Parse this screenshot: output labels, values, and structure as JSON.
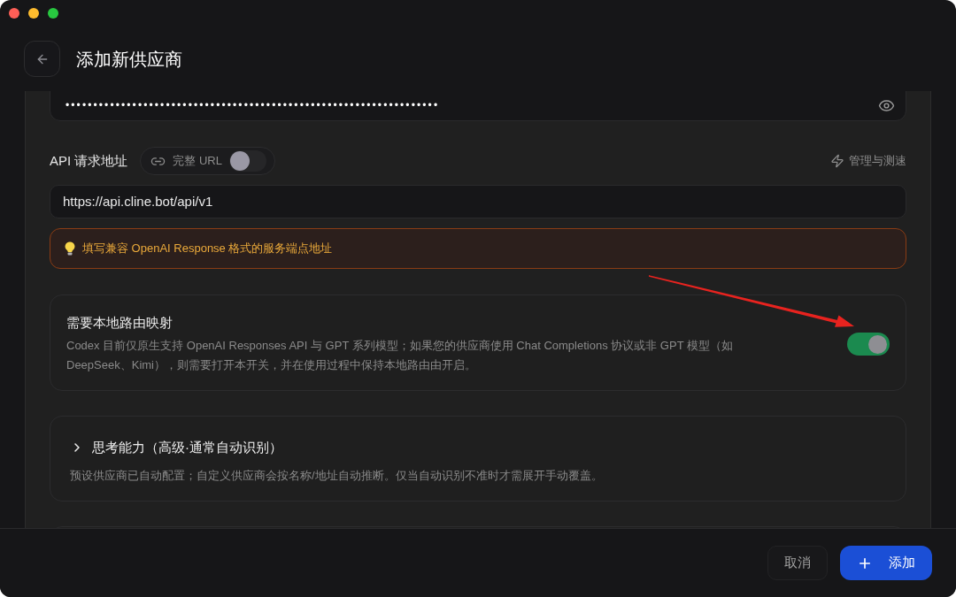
{
  "header": {
    "title": "添加新供应商"
  },
  "api_key_field": {
    "value": "•••••••••••••••••••••••••••••••••••••••••••••••••••••••••••••••••••"
  },
  "endpoint": {
    "label": "API 请求地址",
    "full_url": {
      "label": "完整 URL",
      "on": false
    },
    "manage_link": "管理与测速",
    "value": "https://api.cline.bot/api/v1",
    "hint": "填写兼容 OpenAI Response 格式的服务端点地址"
  },
  "local_routing": {
    "title": "需要本地路由映射",
    "description": "Codex 目前仅原生支持 OpenAI Responses API 与 GPT 系列模型；如果您的供应商使用 Chat Completions 协议或非 GPT 模型（如 DeepSeek、Kimi），则需要打开本开关，并在使用过程中保持本地路由由开启。",
    "on": true
  },
  "thinking": {
    "title": "思考能力（高级·通常自动识别）",
    "description": "预设供应商已自动配置；自定义供应商会按名称/地址自动推断。仅当自动识别不准时才需展开手动覆盖。",
    "expanded": false
  },
  "footer": {
    "buttons": [
      {
        "label": "取消",
        "kind": "secondary"
      },
      {
        "label": "添加",
        "kind": "primary"
      }
    ]
  }
}
